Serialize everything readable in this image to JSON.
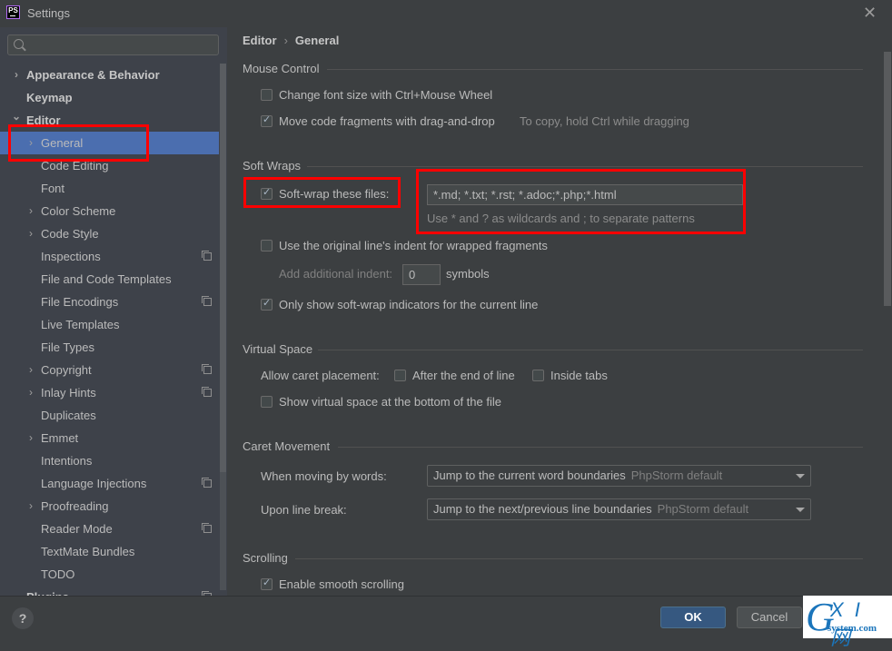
{
  "window": {
    "title": "Settings",
    "app_icon": "PS"
  },
  "sidebar": {
    "search_placeholder": "",
    "items": [
      {
        "label": "Appearance & Behavior",
        "level": 0,
        "chevron": "right",
        "bold": true,
        "copy_icon": false
      },
      {
        "label": "Keymap",
        "level": 0,
        "chevron": "none",
        "bold": true,
        "copy_icon": false
      },
      {
        "label": "Editor",
        "level": 0,
        "chevron": "down",
        "bold": true,
        "copy_icon": false
      },
      {
        "label": "General",
        "level": 1,
        "chevron": "right",
        "bold": false,
        "selected": true,
        "copy_icon": false
      },
      {
        "label": "Code Editing",
        "level": 1,
        "chevron": "none",
        "copy_icon": false
      },
      {
        "label": "Font",
        "level": 1,
        "chevron": "none",
        "copy_icon": false
      },
      {
        "label": "Color Scheme",
        "level": 1,
        "chevron": "right",
        "copy_icon": false
      },
      {
        "label": "Code Style",
        "level": 1,
        "chevron": "right",
        "copy_icon": false
      },
      {
        "label": "Inspections",
        "level": 1,
        "chevron": "none",
        "copy_icon": true
      },
      {
        "label": "File and Code Templates",
        "level": 1,
        "chevron": "none",
        "copy_icon": false
      },
      {
        "label": "File Encodings",
        "level": 1,
        "chevron": "none",
        "copy_icon": true
      },
      {
        "label": "Live Templates",
        "level": 1,
        "chevron": "none",
        "copy_icon": false
      },
      {
        "label": "File Types",
        "level": 1,
        "chevron": "none",
        "copy_icon": false
      },
      {
        "label": "Copyright",
        "level": 1,
        "chevron": "right",
        "copy_icon": true
      },
      {
        "label": "Inlay Hints",
        "level": 1,
        "chevron": "right",
        "copy_icon": true
      },
      {
        "label": "Duplicates",
        "level": 1,
        "chevron": "none",
        "copy_icon": false
      },
      {
        "label": "Emmet",
        "level": 1,
        "chevron": "right",
        "copy_icon": false
      },
      {
        "label": "Intentions",
        "level": 1,
        "chevron": "none",
        "copy_icon": false
      },
      {
        "label": "Language Injections",
        "level": 1,
        "chevron": "none",
        "copy_icon": true
      },
      {
        "label": "Proofreading",
        "level": 1,
        "chevron": "right",
        "copy_icon": false
      },
      {
        "label": "Reader Mode",
        "level": 1,
        "chevron": "none",
        "copy_icon": true
      },
      {
        "label": "TextMate Bundles",
        "level": 1,
        "chevron": "none",
        "copy_icon": false
      },
      {
        "label": "TODO",
        "level": 1,
        "chevron": "none",
        "copy_icon": false
      },
      {
        "label": "Plugins",
        "level": 0,
        "chevron": "none",
        "bold": true,
        "copy_icon": true
      }
    ]
  },
  "breadcrumb": {
    "parent": "Editor",
    "separator": "›",
    "current": "General"
  },
  "mouse_control": {
    "title": "Mouse Control",
    "change_font_size": {
      "label": "Change font size with Ctrl+Mouse Wheel",
      "checked": false
    },
    "move_fragments": {
      "label": "Move code fragments with drag-and-drop",
      "checked": true,
      "hint": "To copy, hold Ctrl while dragging"
    }
  },
  "soft_wraps": {
    "title": "Soft Wraps",
    "soft_wrap_files": {
      "label": "Soft-wrap these files:",
      "checked": true,
      "value": "*.md; *.txt; *.rst; *.adoc;*.php;*.html",
      "hint": "Use * and ? as wildcards and ; to separate patterns"
    },
    "original_indent": {
      "label": "Use the original line's indent for wrapped fragments",
      "checked": false
    },
    "additional_indent": {
      "label": "Add additional indent:",
      "value": "0",
      "suffix": "symbols"
    },
    "indicators": {
      "label": "Only show soft-wrap indicators for the current line",
      "checked": true
    }
  },
  "virtual_space": {
    "title": "Virtual Space",
    "caret_label": "Allow caret placement:",
    "after_end": {
      "label": "After the end of line",
      "checked": false
    },
    "inside_tabs": {
      "label": "Inside tabs",
      "checked": false
    },
    "show_bottom": {
      "label": "Show virtual space at the bottom of the file",
      "checked": false
    }
  },
  "caret_movement": {
    "title": "Caret Movement",
    "by_words": {
      "label": "When moving by words:",
      "value": "Jump to the current word boundaries",
      "secondary": "PhpStorm default"
    },
    "line_break": {
      "label": "Upon line break:",
      "value": "Jump to the next/previous line boundaries",
      "secondary": "PhpStorm default"
    }
  },
  "scrolling": {
    "title": "Scrolling",
    "smooth": {
      "label": "Enable smooth scrolling",
      "checked": true
    }
  },
  "footer": {
    "help": "?",
    "ok": "OK",
    "cancel": "Cancel"
  },
  "watermark": {
    "g": "G",
    "xi": "X I 网",
    "site": "system.com"
  },
  "colors": {
    "selection": "#4b6eaf",
    "annotation": "#ff0000",
    "ok_button": "#365880"
  }
}
